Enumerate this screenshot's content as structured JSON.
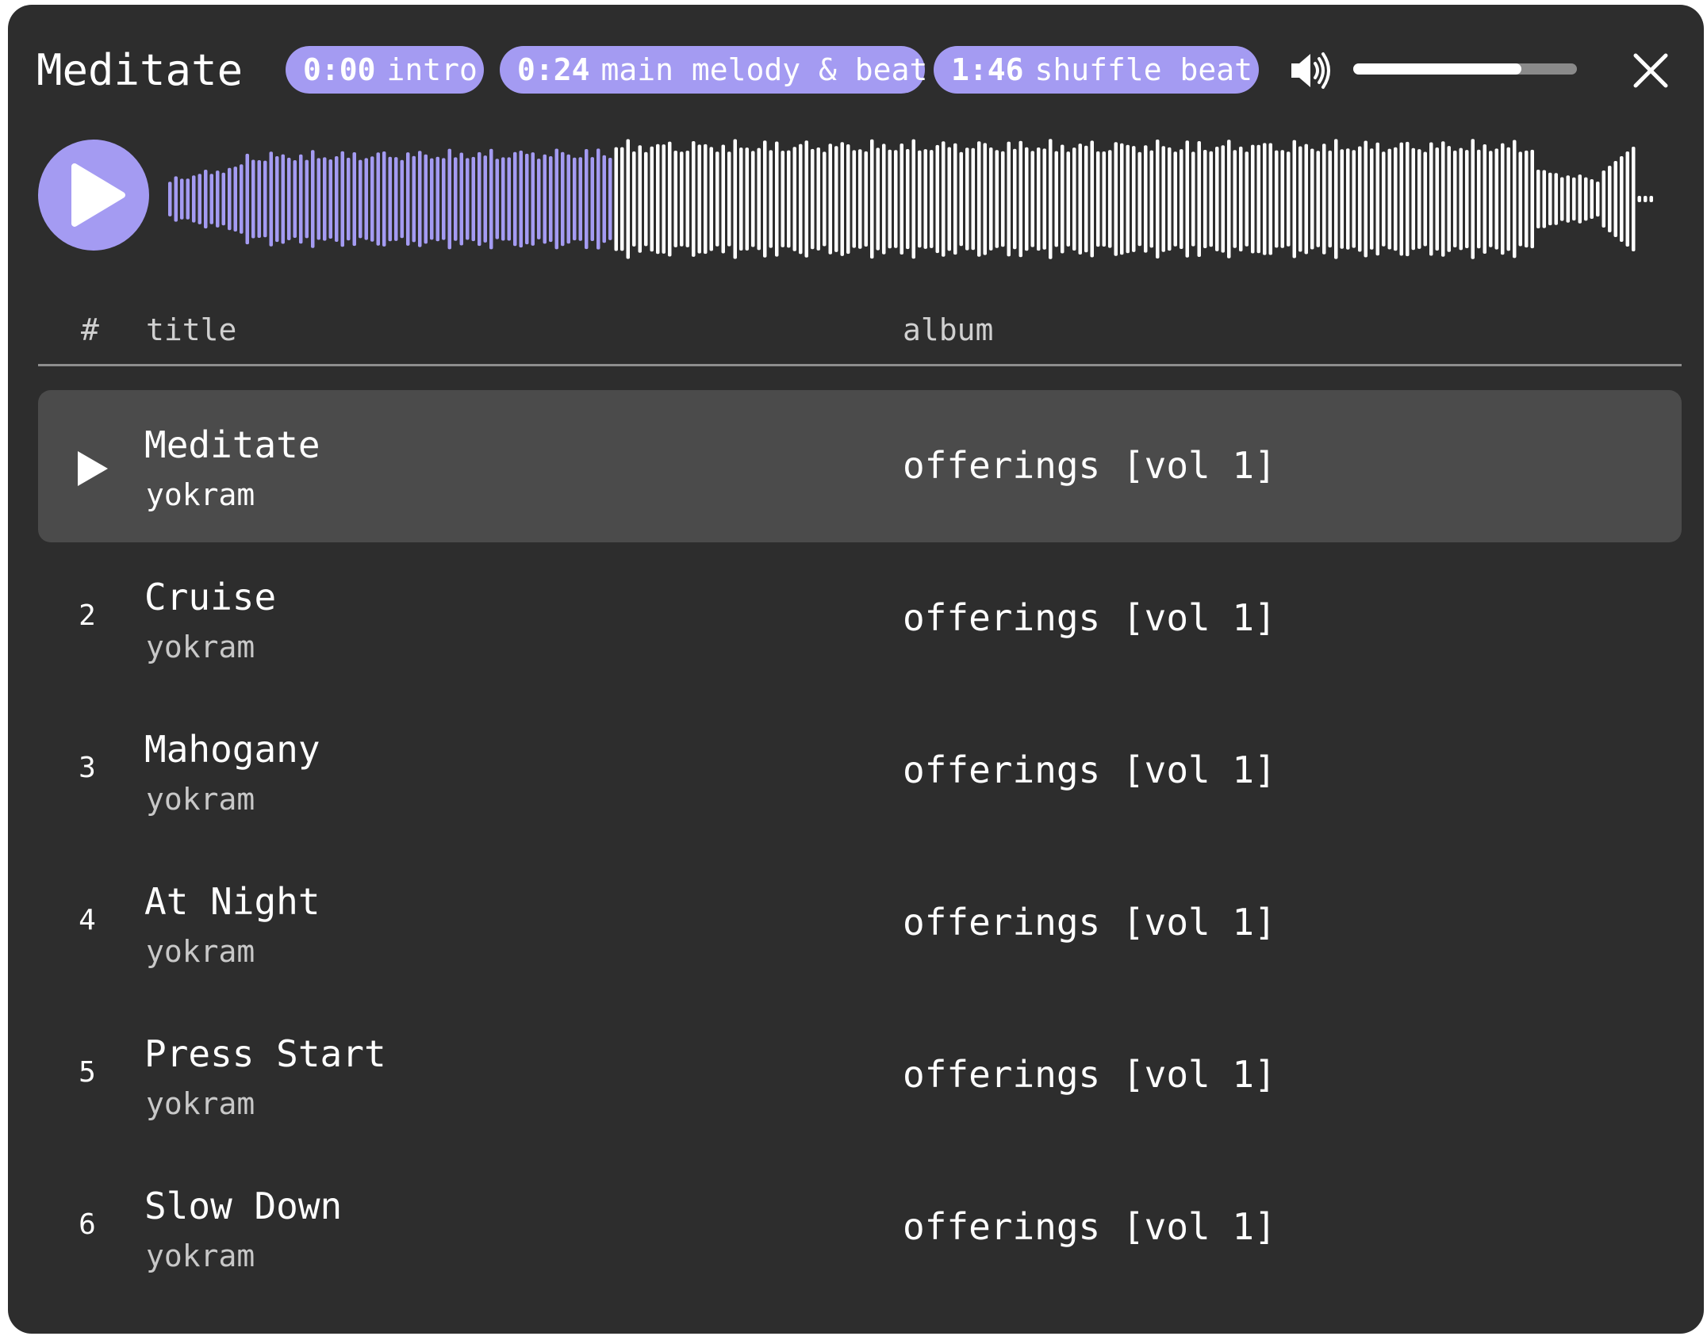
{
  "player": {
    "title": "Meditate",
    "volume_percent": 75,
    "playback_progress": 0.3,
    "accent_color": "#a49bf2",
    "background_color": "#2d2d2d"
  },
  "chapters": [
    {
      "time": "0:00",
      "label": "intro"
    },
    {
      "time": "0:24",
      "label": "main melody & beat"
    },
    {
      "time": "1:46",
      "label": "shuffle beat"
    }
  ],
  "icons": {
    "volume": "volume-icon",
    "close": "close-icon",
    "play": "play-icon"
  },
  "table": {
    "headers": {
      "num": "#",
      "title": "title",
      "album": "album"
    },
    "rows": [
      {
        "num": "",
        "title": "Meditate",
        "artist": "yokram",
        "album": "offerings [vol 1]",
        "active": true
      },
      {
        "num": "2",
        "title": "Cruise",
        "artist": "yokram",
        "album": "offerings [vol 1]"
      },
      {
        "num": "3",
        "title": "Mahogany",
        "artist": "yokram",
        "album": "offerings [vol 1]"
      },
      {
        "num": "4",
        "title": "At Night",
        "artist": "yokram",
        "album": "offerings [vol 1]"
      },
      {
        "num": "5",
        "title": "Press Start",
        "artist": "yokram",
        "album": "offerings [vol 1]"
      },
      {
        "num": "6",
        "title": "Slow Down",
        "artist": "yokram",
        "album": "offerings [vol 1]"
      }
    ]
  }
}
